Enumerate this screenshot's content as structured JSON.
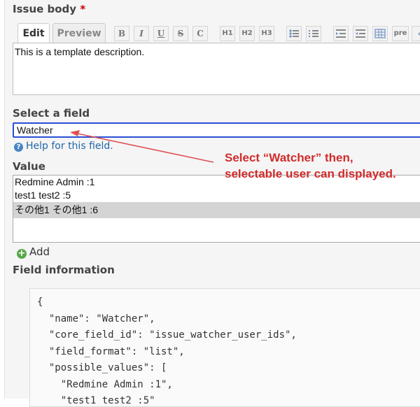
{
  "issue_body": {
    "label": "Issue body",
    "required_mark": "*",
    "tabs": {
      "edit": "Edit",
      "preview": "Preview"
    },
    "toolbar": {
      "bold": "B",
      "italic": "I",
      "underline": "U",
      "strike": "S",
      "code": "C",
      "h1": "H1",
      "h2": "H2",
      "h3": "H3",
      "pre": "pre"
    },
    "text": "This is a template description."
  },
  "select_field": {
    "label": "Select a field",
    "value": "Watcher",
    "help_text": "Help for this field."
  },
  "value_section": {
    "label": "Value",
    "options": [
      "Redmine Admin :1",
      "test1 test2 :5",
      "その他1 その他1 :6"
    ],
    "selected_index": 2,
    "add_label": "Add"
  },
  "field_information": {
    "label": "Field information",
    "code_lines": [
      "{",
      "  \"name\": \"Watcher\",",
      "  \"core_field_id\": \"issue_watcher_user_ids\",",
      "  \"field_format\": \"list\",",
      "  \"possible_values\": [",
      "    \"Redmine Admin :1\",",
      "    \"test1 test2 :5\""
    ]
  },
  "annotation": {
    "line1": "Select “Watcher” then,",
    "line2": "selectable user can displayed."
  },
  "colors": {
    "annotation": "#d12b2b",
    "focus_border": "#2a4fd6",
    "link": "#2267a7",
    "selected_row": "#d4d4d4"
  }
}
